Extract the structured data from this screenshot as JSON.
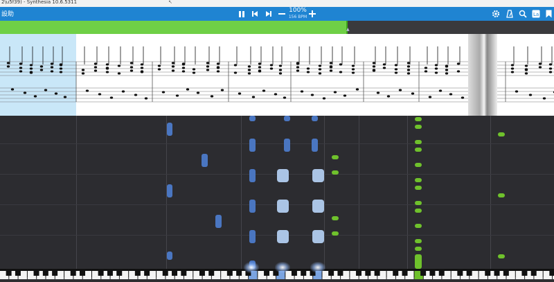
{
  "window": {
    "title": "12&#x2028;4) - Synthesia 10.6.5311"
  },
  "toolbar": {
    "help_label": "設助",
    "zoom_percent": "100%",
    "bpm_text": "156 BPM",
    "icons": {
      "pause": "pause-icon",
      "rewind": "skip-back-icon",
      "forward": "skip-forward-icon",
      "zoom_out": "minus-icon",
      "zoom_in": "plus-icon",
      "settings": "gear-icon",
      "metronome": "metronome-icon",
      "search": "search-icon",
      "labels": "labels-icon",
      "bookmark": "bookmark-icon"
    }
  },
  "progress": {
    "fraction": 0.625,
    "fill_color": "#6fd046"
  },
  "colors": {
    "toolbar": "#1f84d2",
    "right_hand": "#4a76c1",
    "left_hand": "#6fc12c",
    "highlight": "#c9e7f8"
  }
}
